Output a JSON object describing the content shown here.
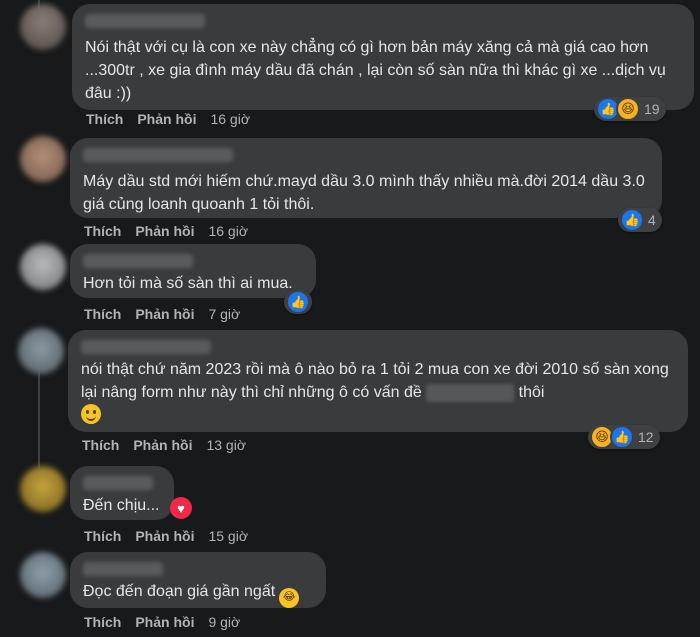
{
  "labels": {
    "like": "Thích",
    "reply": "Phản hồi"
  },
  "comments": [
    {
      "text": "Nói thật với cụ là con xe này chẳng có gì hơn bản máy xăng cả mà giá cao hơn ...300tr , xe gia đình máy dầu đã chán , lại còn số sàn nữa thì khác gì xe ...dịch vụ đâu :))",
      "time": "16 giờ",
      "reactions": [
        "like",
        "haha"
      ],
      "reaction_count": "19"
    },
    {
      "text": "Máy dầu std mới hiếm chứ.mayd dầu 3.0 mình thấy nhiều mà.đời 2014 dầu 3.0 giá củng loanh quoanh 1 tỏi thôi.",
      "time": "16 giờ",
      "reactions": [
        "like"
      ],
      "reaction_count": "4"
    },
    {
      "text": "Hơn tỏi mà số sàn thì ai mua.",
      "time": "7 giờ",
      "reactions": [
        "like"
      ],
      "reaction_count": ""
    },
    {
      "text_before": "nói thật chứ năm 2023 rồi mà ô nào bỏ ra 1 tỏi 2 mua con xe đời 2010 số sàn xong lại nâng form như này thì chỉ những ô có vấn đề",
      "text_after": "thôi",
      "time": "13 giờ",
      "reactions": [
        "haha",
        "like"
      ],
      "reaction_count": "12"
    },
    {
      "text": "Đến chịu...",
      "time": "15 giờ",
      "reactions": [
        "love"
      ],
      "reaction_count": ""
    },
    {
      "text": "Đọc đến đoạn giá gần ngất",
      "time": "9 giờ",
      "reactions": [],
      "reaction_count": ""
    }
  ],
  "colors": {
    "background": "#18191a",
    "bubble": "#3a3b3c",
    "like": "#1877f2",
    "love": "#f02849",
    "haha": "#f7b125"
  }
}
